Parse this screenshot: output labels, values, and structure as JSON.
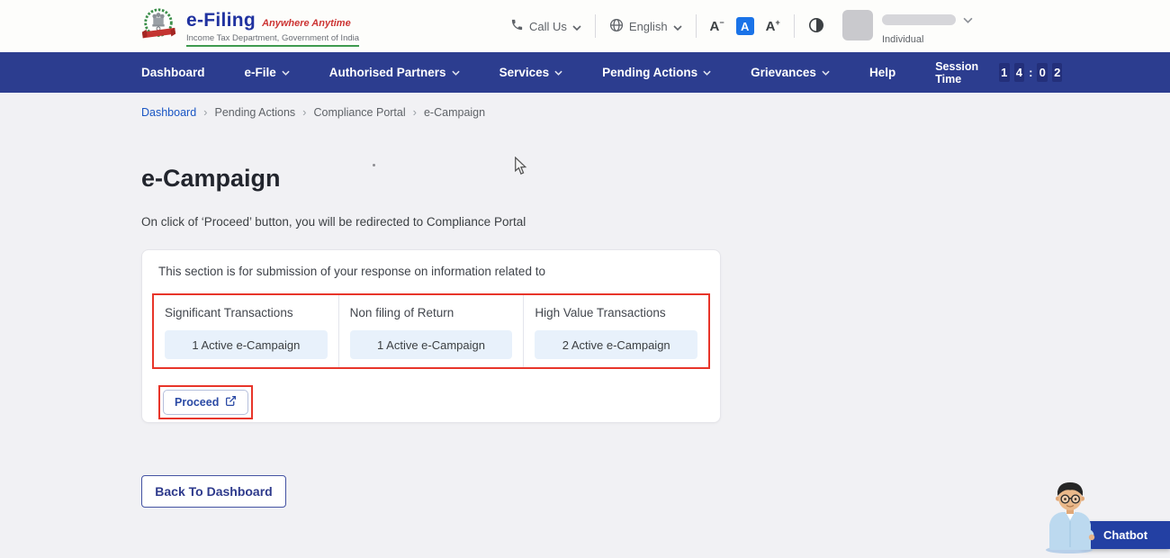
{
  "header": {
    "logo": {
      "title": "e-Filing",
      "tagline": "Anywhere Anytime",
      "subtitle": "Income Tax Department, Government of India"
    },
    "call_us_label": "Call Us",
    "language_label": "English",
    "font_controls": {
      "letter": "A",
      "minus": "−",
      "plus": "+"
    },
    "user": {
      "type_label": "Individual"
    }
  },
  "navbar": {
    "items": [
      {
        "label": "Dashboard",
        "dropdown": false
      },
      {
        "label": "e-File",
        "dropdown": true
      },
      {
        "label": "Authorised Partners",
        "dropdown": true
      },
      {
        "label": "Services",
        "dropdown": true
      },
      {
        "label": "Pending Actions",
        "dropdown": true
      },
      {
        "label": "Grievances",
        "dropdown": true
      },
      {
        "label": "Help",
        "dropdown": false
      }
    ],
    "session": {
      "label": "Session Time",
      "digits": [
        "1",
        "4",
        "0",
        "2"
      ],
      "separator": ":"
    }
  },
  "breadcrumb": {
    "items": [
      "Dashboard",
      "Pending Actions",
      "Compliance Portal",
      "e-Campaign"
    ],
    "separator": "›"
  },
  "page": {
    "title": "e-Campaign",
    "subtitle": "On click of ‘Proceed’ button, you will be redirected to Compliance Portal",
    "card": {
      "intro": "This section is for submission of your response on information related to",
      "categories": [
        {
          "label": "Significant Transactions",
          "badge": "1 Active e-Campaign"
        },
        {
          "label": "Non filing of Return",
          "badge": "1 Active e-Campaign"
        },
        {
          "label": "High Value Transactions",
          "badge": "2 Active e-Campaign"
        }
      ],
      "proceed_label": "Proceed"
    },
    "back_button_label": "Back To Dashboard"
  },
  "chatbot": {
    "label": "Chatbot"
  },
  "colors": {
    "navbar_blue": "#2c3d8f",
    "highlight_red": "#e8352a",
    "badge_bg": "#e8f1fb",
    "link_blue": "#1a56c4",
    "selected_font_control_blue": "#1a73e8",
    "logo_blue": "#2032a0",
    "logo_tagline_red": "#cc3433",
    "logo_underline_green": "#3f9b4f"
  }
}
